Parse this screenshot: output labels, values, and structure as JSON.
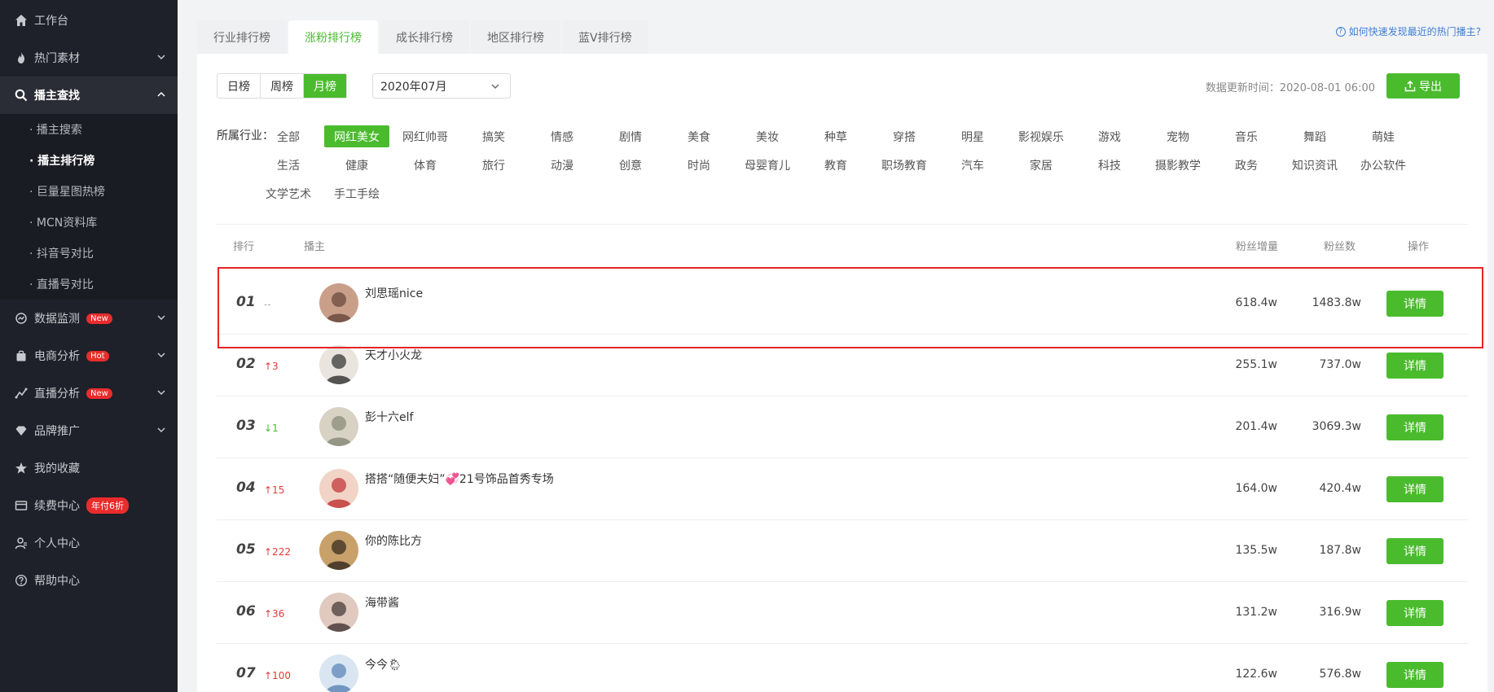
{
  "sidebar": {
    "items": [
      {
        "label": "工作台",
        "icon": "home-icon"
      },
      {
        "label": "热门素材",
        "icon": "fire-icon"
      },
      {
        "label": "播主查找",
        "icon": "search-icon"
      },
      {
        "label": "数据监测",
        "icon": "monitor-icon",
        "badge": "New"
      },
      {
        "label": "电商分析",
        "icon": "bag-icon",
        "badge": "Hot"
      },
      {
        "label": "直播分析",
        "icon": "live-icon",
        "badge": "New"
      },
      {
        "label": "品牌推广",
        "icon": "diamond-icon"
      },
      {
        "label": "我的收藏",
        "icon": "star-icon"
      },
      {
        "label": "续费中心",
        "icon": "card-icon",
        "badge": "年付6折"
      },
      {
        "label": "个人中心",
        "icon": "user-icon"
      },
      {
        "label": "帮助中心",
        "icon": "help-icon"
      }
    ],
    "sub_items": [
      "· 播主搜索",
      "· 播主排行榜",
      "· 巨量星图热榜",
      "· MCN资料库",
      "· 抖音号对比",
      "· 直播号对比"
    ]
  },
  "tabs": [
    "行业排行榜",
    "涨粉排行榜",
    "成长排行榜",
    "地区排行榜",
    "蓝V排行榜"
  ],
  "active_tab": "涨粉排行榜",
  "help_link": "如何快速发现最近的热门播主?",
  "filters": {
    "periods": [
      "日榜",
      "周榜",
      "月榜"
    ],
    "active_period": "月榜",
    "date": "2020年07月",
    "update_time": "数据更新时间：2020-08-01 06:00",
    "export_label": "导出"
  },
  "industry": {
    "label": "所属行业：",
    "active": "网红美女",
    "options": [
      "全部",
      "网红美女",
      "网红帅哥",
      "搞笑",
      "情感",
      "剧情",
      "美食",
      "美妆",
      "种草",
      "穿搭",
      "明星",
      "影视娱乐",
      "游戏",
      "宠物",
      "音乐",
      "舞蹈",
      "萌娃",
      "生活",
      "健康",
      "体育",
      "旅行",
      "动漫",
      "创意",
      "时尚",
      "母婴育儿",
      "教育",
      "职场教育",
      "汽车",
      "家居",
      "科技",
      "摄影教学",
      "政务",
      "知识资讯",
      "办公软件",
      "文学艺术",
      "手工手绘"
    ]
  },
  "table": {
    "headers": {
      "rank": "排行",
      "creator": "播主",
      "fan_inc": "粉丝增量",
      "fans": "粉丝数",
      "action": "操作"
    },
    "detail_label": "详情",
    "rows": [
      {
        "rank": "01",
        "trend": "--",
        "trend_dir": "flat",
        "name": "刘思瑶nice",
        "fan_inc": "618.4w",
        "fans": "1483.8w"
      },
      {
        "rank": "02",
        "trend": "↑3",
        "trend_dir": "up",
        "name": "天才小火龙",
        "fan_inc": "255.1w",
        "fans": "737.0w"
      },
      {
        "rank": "03",
        "trend": "↓1",
        "trend_dir": "down",
        "name": "彭十六elf",
        "fan_inc": "201.4w",
        "fans": "3069.3w"
      },
      {
        "rank": "04",
        "trend": "↑15",
        "trend_dir": "up",
        "name": "搭搭“随便夫妇”💞21号饰品首秀专场",
        "fan_inc": "164.0w",
        "fans": "420.4w"
      },
      {
        "rank": "05",
        "trend": "↑222",
        "trend_dir": "up",
        "name": "你的陈比方",
        "fan_inc": "135.5w",
        "fans": "187.8w"
      },
      {
        "rank": "06",
        "trend": "↑36",
        "trend_dir": "up",
        "name": "海带酱",
        "fan_inc": "131.2w",
        "fans": "316.9w"
      },
      {
        "rank": "07",
        "trend": "↑100",
        "trend_dir": "up",
        "name": "今今🌦",
        "fan_inc": "122.6w",
        "fans": "576.8w"
      }
    ]
  },
  "colors": {
    "accent": "#4bbb2e",
    "sidebar_bg": "#1e2129",
    "highlight": "#e62424"
  }
}
